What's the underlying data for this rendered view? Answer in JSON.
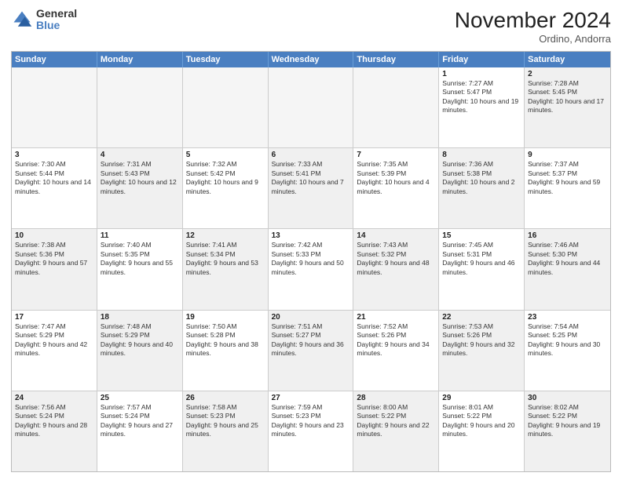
{
  "logo": {
    "general": "General",
    "blue": "Blue"
  },
  "header": {
    "month": "November 2024",
    "location": "Ordino, Andorra"
  },
  "weekdays": [
    "Sunday",
    "Monday",
    "Tuesday",
    "Wednesday",
    "Thursday",
    "Friday",
    "Saturday"
  ],
  "rows": [
    [
      {
        "day": "",
        "text": "",
        "empty": true
      },
      {
        "day": "",
        "text": "",
        "empty": true
      },
      {
        "day": "",
        "text": "",
        "empty": true
      },
      {
        "day": "",
        "text": "",
        "empty": true
      },
      {
        "day": "",
        "text": "",
        "empty": true
      },
      {
        "day": "1",
        "text": "Sunrise: 7:27 AM\nSunset: 5:47 PM\nDaylight: 10 hours and 19 minutes."
      },
      {
        "day": "2",
        "text": "Sunrise: 7:28 AM\nSunset: 5:45 PM\nDaylight: 10 hours and 17 minutes.",
        "shaded": true
      }
    ],
    [
      {
        "day": "3",
        "text": "Sunrise: 7:30 AM\nSunset: 5:44 PM\nDaylight: 10 hours and 14 minutes."
      },
      {
        "day": "4",
        "text": "Sunrise: 7:31 AM\nSunset: 5:43 PM\nDaylight: 10 hours and 12 minutes.",
        "shaded": true
      },
      {
        "day": "5",
        "text": "Sunrise: 7:32 AM\nSunset: 5:42 PM\nDaylight: 10 hours and 9 minutes."
      },
      {
        "day": "6",
        "text": "Sunrise: 7:33 AM\nSunset: 5:41 PM\nDaylight: 10 hours and 7 minutes.",
        "shaded": true
      },
      {
        "day": "7",
        "text": "Sunrise: 7:35 AM\nSunset: 5:39 PM\nDaylight: 10 hours and 4 minutes."
      },
      {
        "day": "8",
        "text": "Sunrise: 7:36 AM\nSunset: 5:38 PM\nDaylight: 10 hours and 2 minutes.",
        "shaded": true
      },
      {
        "day": "9",
        "text": "Sunrise: 7:37 AM\nSunset: 5:37 PM\nDaylight: 9 hours and 59 minutes."
      }
    ],
    [
      {
        "day": "10",
        "text": "Sunrise: 7:38 AM\nSunset: 5:36 PM\nDaylight: 9 hours and 57 minutes.",
        "shaded": true
      },
      {
        "day": "11",
        "text": "Sunrise: 7:40 AM\nSunset: 5:35 PM\nDaylight: 9 hours and 55 minutes."
      },
      {
        "day": "12",
        "text": "Sunrise: 7:41 AM\nSunset: 5:34 PM\nDaylight: 9 hours and 53 minutes.",
        "shaded": true
      },
      {
        "day": "13",
        "text": "Sunrise: 7:42 AM\nSunset: 5:33 PM\nDaylight: 9 hours and 50 minutes."
      },
      {
        "day": "14",
        "text": "Sunrise: 7:43 AM\nSunset: 5:32 PM\nDaylight: 9 hours and 48 minutes.",
        "shaded": true
      },
      {
        "day": "15",
        "text": "Sunrise: 7:45 AM\nSunset: 5:31 PM\nDaylight: 9 hours and 46 minutes."
      },
      {
        "day": "16",
        "text": "Sunrise: 7:46 AM\nSunset: 5:30 PM\nDaylight: 9 hours and 44 minutes.",
        "shaded": true
      }
    ],
    [
      {
        "day": "17",
        "text": "Sunrise: 7:47 AM\nSunset: 5:29 PM\nDaylight: 9 hours and 42 minutes."
      },
      {
        "day": "18",
        "text": "Sunrise: 7:48 AM\nSunset: 5:29 PM\nDaylight: 9 hours and 40 minutes.",
        "shaded": true
      },
      {
        "day": "19",
        "text": "Sunrise: 7:50 AM\nSunset: 5:28 PM\nDaylight: 9 hours and 38 minutes."
      },
      {
        "day": "20",
        "text": "Sunrise: 7:51 AM\nSunset: 5:27 PM\nDaylight: 9 hours and 36 minutes.",
        "shaded": true
      },
      {
        "day": "21",
        "text": "Sunrise: 7:52 AM\nSunset: 5:26 PM\nDaylight: 9 hours and 34 minutes."
      },
      {
        "day": "22",
        "text": "Sunrise: 7:53 AM\nSunset: 5:26 PM\nDaylight: 9 hours and 32 minutes.",
        "shaded": true
      },
      {
        "day": "23",
        "text": "Sunrise: 7:54 AM\nSunset: 5:25 PM\nDaylight: 9 hours and 30 minutes."
      }
    ],
    [
      {
        "day": "24",
        "text": "Sunrise: 7:56 AM\nSunset: 5:24 PM\nDaylight: 9 hours and 28 minutes.",
        "shaded": true
      },
      {
        "day": "25",
        "text": "Sunrise: 7:57 AM\nSunset: 5:24 PM\nDaylight: 9 hours and 27 minutes."
      },
      {
        "day": "26",
        "text": "Sunrise: 7:58 AM\nSunset: 5:23 PM\nDaylight: 9 hours and 25 minutes.",
        "shaded": true
      },
      {
        "day": "27",
        "text": "Sunrise: 7:59 AM\nSunset: 5:23 PM\nDaylight: 9 hours and 23 minutes."
      },
      {
        "day": "28",
        "text": "Sunrise: 8:00 AM\nSunset: 5:22 PM\nDaylight: 9 hours and 22 minutes.",
        "shaded": true
      },
      {
        "day": "29",
        "text": "Sunrise: 8:01 AM\nSunset: 5:22 PM\nDaylight: 9 hours and 20 minutes."
      },
      {
        "day": "30",
        "text": "Sunrise: 8:02 AM\nSunset: 5:22 PM\nDaylight: 9 hours and 19 minutes.",
        "shaded": true
      }
    ]
  ]
}
